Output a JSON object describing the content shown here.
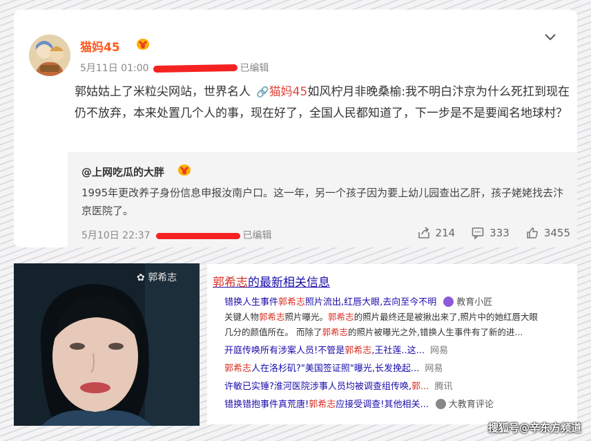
{
  "post": {
    "username": "猫妈45",
    "meta_prefix": "5月11日 01:00",
    "meta_suffix": "已编辑",
    "body_before": "郭姑姑上了米粒尖网站，世界名人",
    "mention_name": "猫妈45",
    "body_after": "如风柠月非晚桑榆:我不明白汴京为什么死扛到现在仍不放弃，本来处置几个人的事，现在好了，全国人民都知道了，下一步是不是要闻名地球村？"
  },
  "repost": {
    "user": "@上网吃瓜的大胖",
    "text": "1995年更改养子身份信息申报汝南户口。这一年，另一个孩子因为要上幼儿园查出乙肝，孩子姥姥找去汴京医院了。",
    "meta_prefix": "5月10日 22:37",
    "meta_suffix": "已编辑",
    "shares": "214",
    "comments": "333",
    "likes": "3455"
  },
  "photo": {
    "caption": "郭希志"
  },
  "search": {
    "title_kw": "郭希志",
    "title_rest": "的最新相关信息",
    "r1_a": "错换人生事件",
    "r1_kw": "郭希志",
    "r1_b": "照片流出,红唇大眼,去向至今不明",
    "r1_src": "教育小匠",
    "d1_a": "关键人物",
    "d1_kw": "郭希志",
    "d1_b": "照片曝光。",
    "d1_kw2": "郭希志",
    "d1_c": "的照片最终还是被揪出来了,照片中的她红唇大眼",
    "d2_a": "几分的颜值所在。 而除了",
    "d2_kw": "郭希志",
    "d2_b": "的照片被曝光之外,错换人生事件有了新的进...",
    "r2_a": "开庭传唤所有涉案人员!不管是",
    "r2_kw": "郭希志",
    "r2_b": ",王社莲..这...",
    "r2_src": "网易",
    "r3_kw": "郭希志",
    "r3_a": "人在洛杉矶?\"美国签证照\"曝光,长发挽起...",
    "r3_src": "网易",
    "r4_a": "许敏已实锤?淮河医院涉事人员均被调查组传唤,",
    "r4_kw": "郭...",
    "r4_src": "腾讯",
    "r5_a": "错换错抱事件真荒唐!",
    "r5_kw": "郭希志",
    "r5_b": "应接受调查!其他相关...",
    "r5_src": "大教育评论"
  },
  "watermark": "搜狐号@辛东方频道",
  "colors": {
    "username": "#ff5a1f",
    "mention": "#e0453a",
    "redaction": "#f52222",
    "link": "#1a0dab",
    "keyword": "#d93025"
  },
  "icons": [
    "avatar",
    "vip-badge",
    "chevron-down-icon",
    "link-icon",
    "share-icon",
    "comment-icon",
    "like-icon"
  ]
}
